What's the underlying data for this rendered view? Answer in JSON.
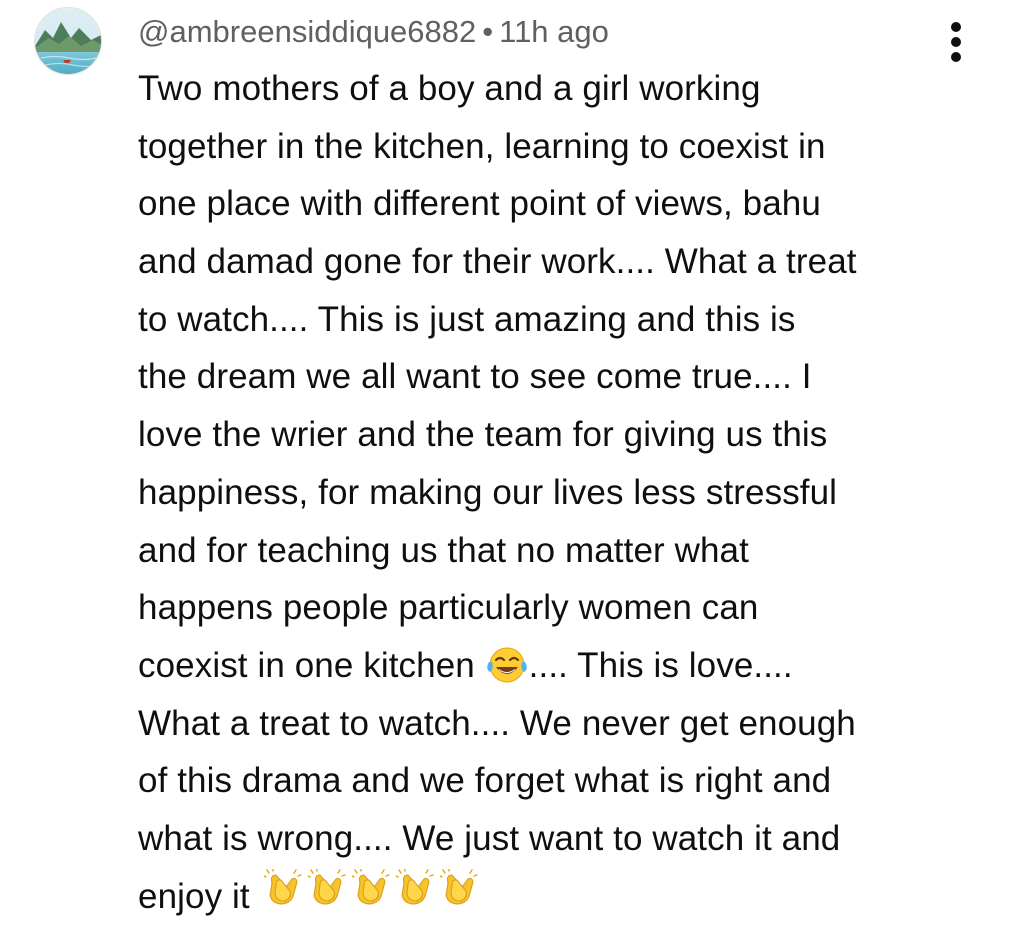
{
  "comment": {
    "handle": "@ambreensiddique6882",
    "separator": "•",
    "time": "11h ago",
    "menu_icon": "vertical-ellipsis-icon",
    "lines": [
      "Two mothers of a boy and a girl working",
      "together in the kitchen, learning to coexist in",
      "one place with different point of views, bahu",
      "and damad gone for their work.... What a treat",
      "to watch.... This is just amazing and this is",
      "the dream we all want to see come true.... I",
      "love the wrier and the team for giving us this",
      "happiness, for making our lives less stressful",
      "and for teaching us that no matter what",
      "happens people particularly women can"
    ],
    "line_emoji_before": "coexist in one kitchen ",
    "line_emoji_icon": "face-with-tears-of-joy-emoji",
    "line_emoji_after": ".... This is love....",
    "lines_after": [
      "What a treat to watch.... We never get enough",
      "of this drama and we forget what is right and",
      "what is wrong.... We just want to watch it and"
    ],
    "last_line_text": "enjoy it ",
    "clap_icon": "clapping-hands-emoji",
    "clap_count": 5
  },
  "colors": {
    "text": "#0f0f0f",
    "meta_text": "#606060",
    "background": "#ffffff"
  }
}
